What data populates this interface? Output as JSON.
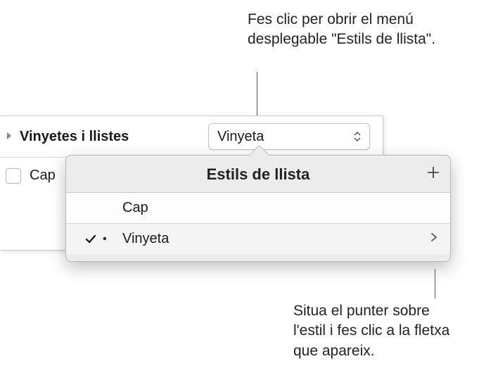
{
  "callouts": {
    "top": "Fes clic per obrir el menú desplegable \"Estils de llista\".",
    "bottom": "Situa el punter sobre l'estil i fes clic a la fletxa que apareix."
  },
  "panel": {
    "section_label": "Vinyetes i llistes",
    "dropdown_value": "Vinyeta",
    "truncated_label": "Cap"
  },
  "popover": {
    "title": "Estils de llista",
    "items": [
      {
        "label": "Cap",
        "selected": false,
        "icon": ""
      },
      {
        "label": "Vinyeta",
        "selected": true,
        "icon": "•"
      }
    ]
  }
}
